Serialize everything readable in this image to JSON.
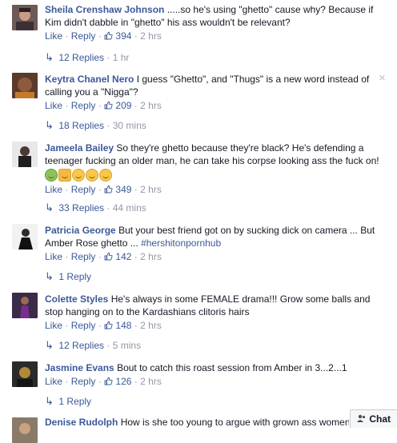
{
  "comments": [
    {
      "author": "Sheila Crenshaw Johnson",
      "text": ".....so he's using \"ghetto\" cause why? Because if Kim didn't dabble in \"ghetto\" his ass wouldn't be relevant?",
      "like": "Like",
      "reply": "Reply",
      "likes": "394",
      "time": "2 hrs",
      "replies": "12 Replies",
      "replies_time": "1 hr"
    },
    {
      "author": "Keytra Chanel Nero",
      "text": "I guess \"Ghetto\", and \"Thugs\" is a new word instead of calling you a \"Nigga\"?",
      "like": "Like",
      "reply": "Reply",
      "likes": "209",
      "time": "2 hrs",
      "replies": "18 Replies",
      "replies_time": "30 mins"
    },
    {
      "author": "Jameela Bailey",
      "text": "So they're ghetto because they're black? He's defending a teenager fucking an older man, he can take his corpse looking ass the fuck on!",
      "like": "Like",
      "reply": "Reply",
      "likes": "349",
      "time": "2 hrs",
      "replies": "33 Replies",
      "replies_time": "44 mins"
    },
    {
      "author": "Patricia George",
      "text": "But your best friend got on by sucking dick on camera ... But Amber Rose ghetto ...",
      "hashtag": "#hershitonpornhub",
      "like": "Like",
      "reply": "Reply",
      "likes": "142",
      "time": "2 hrs",
      "replies": "1 Reply"
    },
    {
      "author": "Colette Styles",
      "text": "He's always in some FEMALE drama!!! Grow some balls and stop hanging on to the Kardashians clitoris hairs",
      "like": "Like",
      "reply": "Reply",
      "likes": "148",
      "time": "2 hrs",
      "replies": "12 Replies",
      "replies_time": "5 mins"
    },
    {
      "author": "Jasmine Evans",
      "text": "Bout to catch this roast session from Amber in 3...2...1",
      "like": "Like",
      "reply": "Reply",
      "likes": "126",
      "time": "2 hrs",
      "replies": "1 Reply"
    },
    {
      "author": "Denise Rudolph",
      "text": "How is she too young to argue with grown ass women"
    }
  ],
  "separator": "·",
  "close_glyph": "×",
  "reply_arrow": "↳",
  "chat": {
    "label": "Chat"
  },
  "icons": {
    "close": "close-icon",
    "thumb": "thumbs-up-icon",
    "reply_arrow": "reply-arrow-icon",
    "chat": "chat-people-icon"
  },
  "colors": {
    "link": "#3b5998",
    "meta": "#9197a3",
    "text": "#141823"
  }
}
